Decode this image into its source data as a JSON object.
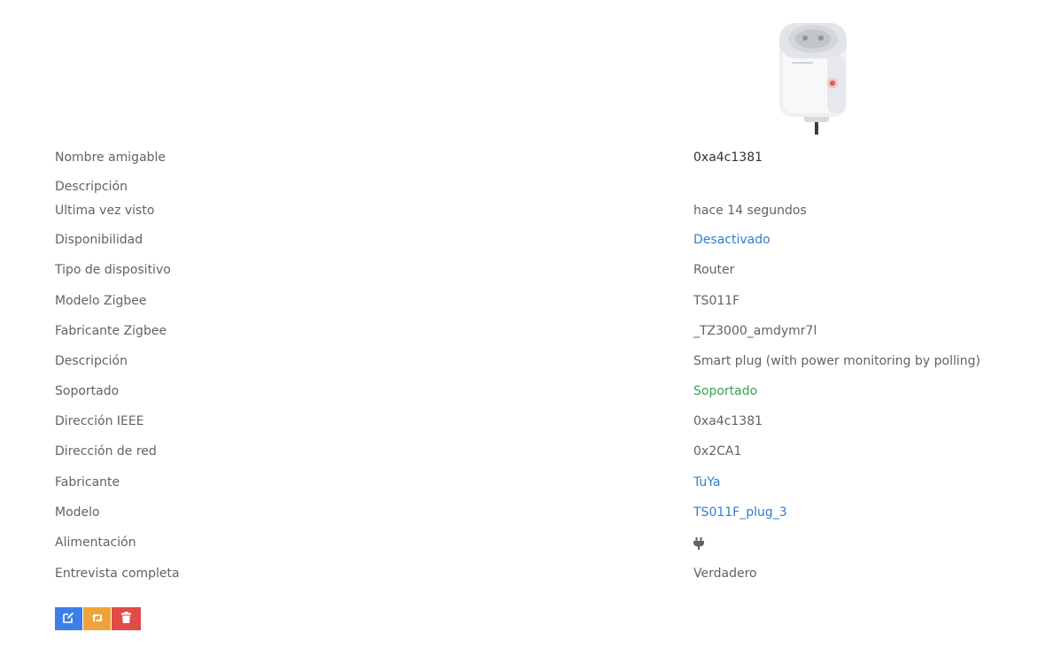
{
  "device": {
    "image_icon": "smart-plug-image"
  },
  "rows": [
    {
      "label": "Nombre amigable",
      "value": "0xa4c1381"
    },
    {
      "label": "Descripción",
      "value": ""
    },
    {
      "label": "Ultima vez visto",
      "value": "hace 14 segundos"
    },
    {
      "label": "Disponibilidad",
      "value": "Desactivado"
    },
    {
      "label": "Tipo de dispositivo",
      "value": "Router"
    },
    {
      "label": "Modelo Zigbee",
      "value": "TS011F"
    },
    {
      "label": "Fabricante Zigbee",
      "value": "_TZ3000_amdymr7l"
    },
    {
      "label": "Descripción",
      "value": "Smart plug (with power monitoring by polling)"
    },
    {
      "label": "Soportado",
      "value": "Soportado"
    },
    {
      "label": "Dirección IEEE",
      "value": "0xa4c1381"
    },
    {
      "label": "Dirección de red",
      "value": "0x2CA1"
    },
    {
      "label": "Fabricante",
      "value": "TuYa"
    },
    {
      "label": "Modelo",
      "value": "TS011F_plug_3"
    },
    {
      "label": "Alimentación",
      "value": "plug-icon"
    },
    {
      "label": "Entrevista completa",
      "value": "Verdadero"
    }
  ],
  "actions": {
    "edit_icon": "edit-icon",
    "reconfigure_icon": "retweet-icon",
    "delete_icon": "trash-icon"
  },
  "colors": {
    "link": "#2f7dd1",
    "success": "#3aa25a",
    "edit_button": "#3d7ee8",
    "reconfigure_button": "#f0a33a",
    "delete_button": "#e14b47"
  }
}
